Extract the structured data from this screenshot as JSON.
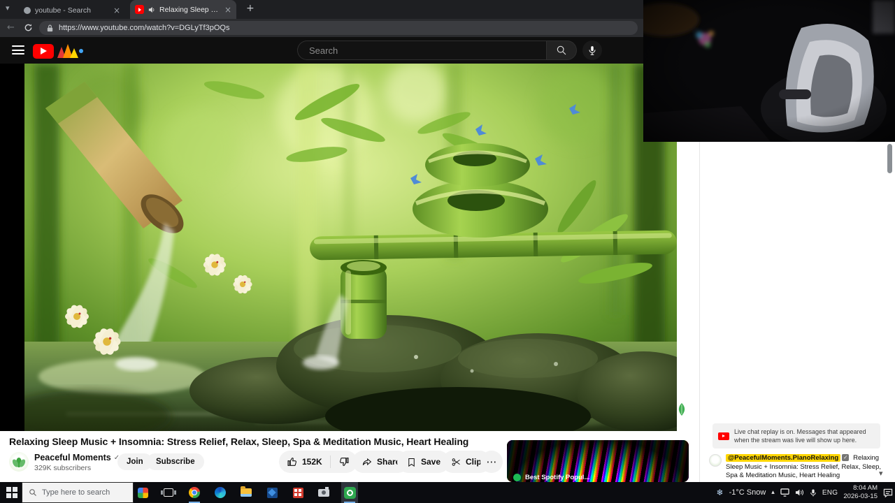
{
  "icons": {
    "close": "×",
    "plus": "+",
    "back": "←",
    "more": "⋯",
    "check": "✓",
    "chevron_down": "▾",
    "chevron_up": "▴",
    "snow": "❄"
  },
  "colors": {
    "youtube_red": "#ff0000",
    "member_chip_yellow": "#ffd600",
    "spotify_green": "#1db954"
  },
  "browser": {
    "tabs": [
      {
        "title": "youtube - Search"
      },
      {
        "title": "Relaxing Sleep Music + Inson"
      }
    ],
    "url": "https://www.youtube.com/watch?v=DGLyTf3pOQs"
  },
  "masthead": {
    "search_placeholder": "Search"
  },
  "video_page": {
    "title": "Relaxing Sleep Music + Insomnia: Stress Relief, Relax, Sleep, Spa & Meditation Music, Heart Healing",
    "channel_name": "Peaceful Moments",
    "subscribers": "329K subscribers",
    "join_label": "Join",
    "subscribe_label": "Subscribe",
    "like_count": "152K",
    "share_label": "Share",
    "save_label": "Save",
    "clip_label": "Clip",
    "related_caption": "Best Spotify Popul..."
  },
  "live_chat": {
    "notice": "Live chat replay is on. Messages that appeared when the stream was live will show up here.",
    "message": {
      "author": "@PeacefulMoments.PianoRelaxing",
      "text": "Relaxing Sleep Music + Insomnia: Stress Relief, Relax, Sleep, Spa & Meditation Music, Heart Healing"
    }
  },
  "taskbar": {
    "search_placeholder": "Type here to search",
    "weather": "-1°C Snow",
    "language": "ENG",
    "time": "8:04 AM",
    "date": "2026-03-15"
  }
}
